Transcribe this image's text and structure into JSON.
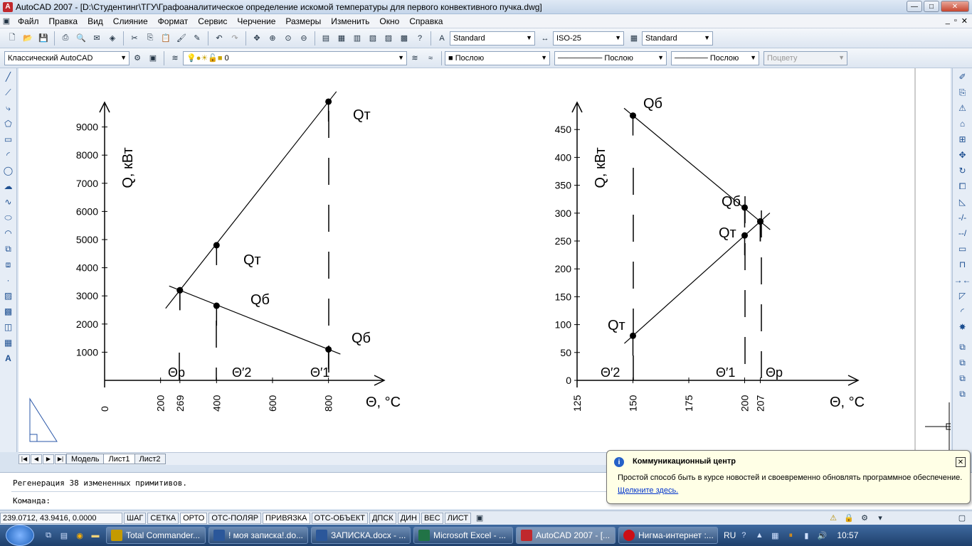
{
  "window": {
    "title": "AutoCAD 2007 - [D:\\Студентинг\\ТГУ\\Графоаналитическое определение искомой температуры для первого конвективного пучка.dwg]"
  },
  "menu": [
    "Файл",
    "Правка",
    "Вид",
    "Слияние",
    "Формат",
    "Сервис",
    "Черчение",
    "Размеры",
    "Изменить",
    "Окно",
    "Справка"
  ],
  "toolbar1": {
    "text_style": "Standard",
    "dim_style": "ISO-25",
    "table_style": "Standard"
  },
  "toolbar2": {
    "workspace": "Классический AutoCAD",
    "layer": "0",
    "color": "Послою",
    "linetype": "Послою",
    "lineweight": "Послою",
    "plotstyle": "Поцвету"
  },
  "tabs": [
    "Модель",
    "Лист1",
    "Лист2"
  ],
  "command": {
    "line1": "Регенерация 38 измененных примитивов.",
    "prompt": "Команда:"
  },
  "status": {
    "coords": "239.0712, 43.9416, 0.0000",
    "buttons": [
      "ШАГ",
      "СЕТКА",
      "ОРТО",
      "ОТС-ПОЛЯР",
      "ПРИВЯЗКА",
      "ОТС-ОБЪЕКТ",
      "ДПСК",
      "ДИН",
      "ВЕС",
      "ЛИСТ"
    ]
  },
  "balloon": {
    "title": "Коммуникационный центр",
    "text": "Простой способ быть в курсе новостей и своевременно обновлять программное обеспечение.",
    "link": "Щелкните здесь."
  },
  "taskbar": {
    "items": [
      "Total Commander...",
      "! моя записка!.do...",
      "ЗАПИСКА.docx - ...",
      "Microsoft Excel - ...",
      "AutoCAD 2007 - [...",
      "Нигма-интернет :..."
    ],
    "lang": "RU",
    "time": "10:57"
  },
  "chart_data": [
    {
      "type": "line",
      "ylabel": "Q, кВт",
      "xlabel": "Θ, °C",
      "yticks": [
        1000,
        2000,
        3000,
        4000,
        5000,
        6000,
        7000,
        8000,
        9000
      ],
      "xticks": [
        "0",
        "200",
        "269",
        "400",
        "600",
        "800"
      ],
      "series": [
        {
          "name": "Qт",
          "x": [
            269,
            400,
            800
          ],
          "y": [
            3200,
            4800,
            9900
          ]
        },
        {
          "name": "Qб",
          "x": [
            269,
            400,
            800
          ],
          "y": [
            3200,
            2650,
            1100
          ]
        }
      ],
      "point_labels": [
        "Qт",
        "Qт",
        "Qб",
        "Qб"
      ],
      "markers": [
        "Θр",
        "Θ′2",
        "Θ′1"
      ]
    },
    {
      "type": "line",
      "ylabel": "Q, кВт",
      "xlabel": "Θ, °C",
      "yticks": [
        0,
        50,
        100,
        150,
        200,
        250,
        300,
        350,
        400,
        450
      ],
      "xticks": [
        "125",
        "150",
        "175",
        "200",
        "207"
      ],
      "series": [
        {
          "name": "Qб",
          "x": [
            150,
            200,
            207
          ],
          "y": [
            475,
            310,
            285
          ]
        },
        {
          "name": "Qт",
          "x": [
            150,
            200,
            207
          ],
          "y": [
            80,
            260,
            285
          ]
        }
      ],
      "point_labels": [
        "Qб",
        "Qб",
        "Qт",
        "Qт"
      ],
      "markers": [
        "Θ′2",
        "Θ′1",
        "Θр"
      ]
    }
  ]
}
